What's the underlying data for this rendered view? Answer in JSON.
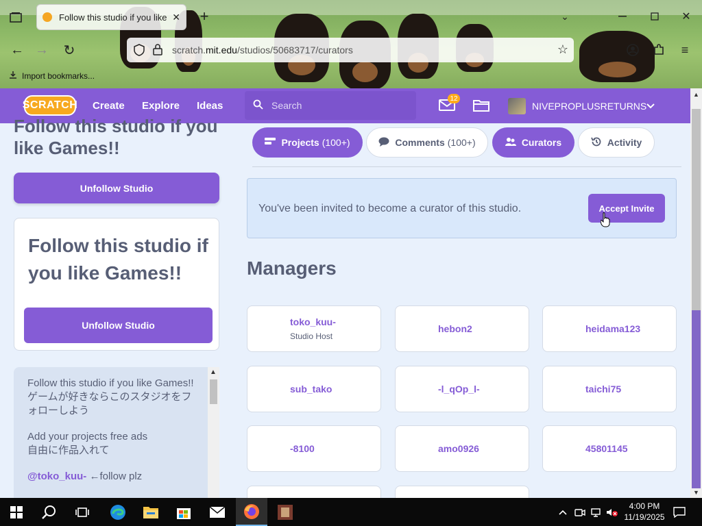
{
  "browser": {
    "tab_title": "Follow this studio if you like Games!!",
    "url_prefix": "scratch.",
    "url_domain": "mit.edu",
    "url_path": "/studios/50683717/curators",
    "bookmark_label": "Import bookmarks..."
  },
  "nav": {
    "logo": "SCRATCH",
    "links": [
      "Create",
      "Explore",
      "Ideas"
    ],
    "search_placeholder": "Search",
    "message_count": "12",
    "username": "NIVEPROPLUSRETURNS"
  },
  "studio": {
    "title": "Follow this studio if you like Games!!",
    "unfollow_label": "Unfollow Studio",
    "thumbnail_text": "Follow this studio if you like Games!!",
    "thumbnail_button": "Unfollow Studio",
    "description": [
      "Follow this studio if you like Games!!",
      "ゲームが好きならこのスタジオをフォローしよう",
      "Add your projects   free ads",
      "自由に作品入れて"
    ],
    "mention": "@toko_kuu-",
    "mention_suffix": " ←follow plz"
  },
  "tabs": [
    {
      "label": "Projects",
      "count": "(100+)",
      "active": true
    },
    {
      "label": "Comments",
      "count": "(100+)",
      "active": false
    },
    {
      "label": "Curators",
      "count": "",
      "active": true
    },
    {
      "label": "Activity",
      "count": "",
      "active": false
    }
  ],
  "invite": {
    "message": "You've been invited to become a curator of this studio.",
    "button": "Accept Invite"
  },
  "managers": {
    "heading": "Managers",
    "items": [
      {
        "name": "toko_kuu-",
        "role": "Studio Host"
      },
      {
        "name": "hebon2",
        "role": ""
      },
      {
        "name": "heidama123",
        "role": ""
      },
      {
        "name": "sub_tako",
        "role": ""
      },
      {
        "name": "-l_qOp_l-",
        "role": ""
      },
      {
        "name": "taichi75",
        "role": ""
      },
      {
        "name": "-8100",
        "role": ""
      },
      {
        "name": "amo0926",
        "role": ""
      },
      {
        "name": "45801145",
        "role": ""
      }
    ]
  },
  "taskbar": {
    "time": "4:00 PM",
    "date": "11/19/2025"
  },
  "colors": {
    "scratch_purple": "#855cd6",
    "page_bg": "#e9f1fc",
    "text": "#575e75"
  }
}
